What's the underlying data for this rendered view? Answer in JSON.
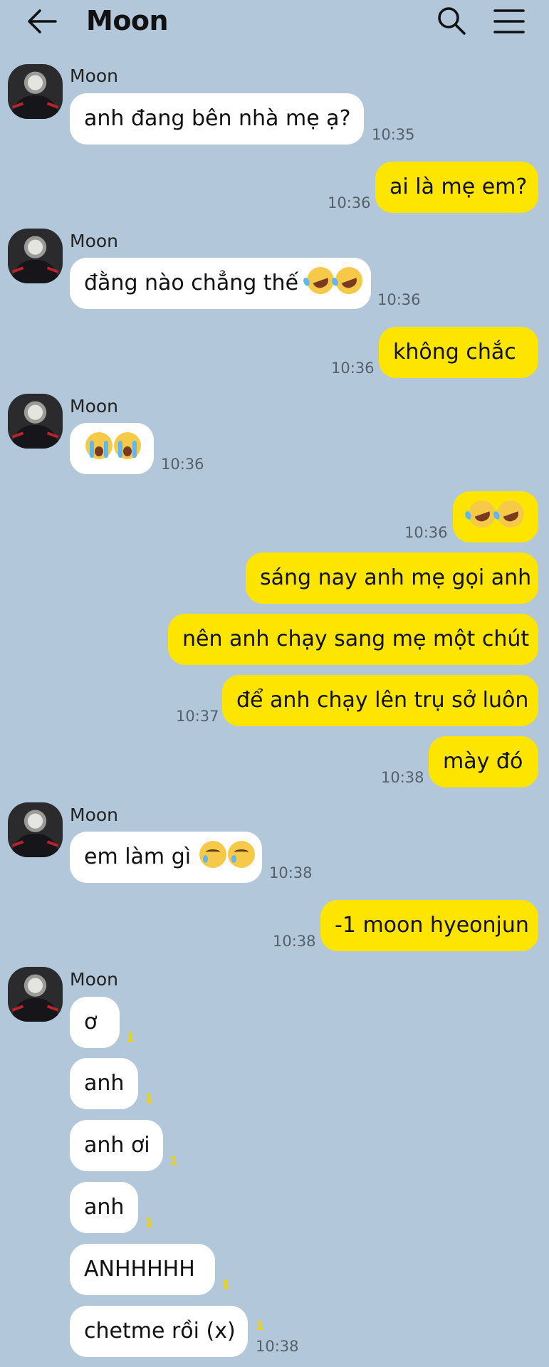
{
  "header": {
    "title": "Moon"
  },
  "icons": {
    "back": "arrow-left-icon",
    "search": "search-icon",
    "menu": "hamburger-menu-icon"
  },
  "colors": {
    "background": "#b2c7d9",
    "incoming_bubble": "#ffffff",
    "outgoing_bubble": "#fee500",
    "unread": "#f0d400"
  },
  "messages": {
    "sender_name": "Moon",
    "m1": {
      "text": "anh đang bên nhà mẹ ạ?",
      "time": "10:35"
    },
    "m2": {
      "text": "ai là mẹ em?",
      "time": "10:36"
    },
    "m3": {
      "text": "đằng nào chẳng thế",
      "emoji": [
        "rofl",
        "rofl"
      ],
      "time": "10:36"
    },
    "m4": {
      "text": "không chắc",
      "time": "10:36"
    },
    "m5": {
      "emoji": [
        "loudly-crying",
        "loudly-crying"
      ],
      "time": "10:36"
    },
    "m6": {
      "emoji": [
        "rofl",
        "rofl"
      ],
      "time": "10:36"
    },
    "m7": {
      "text": "sáng nay anh mẹ gọi anh"
    },
    "m8": {
      "text": "nên anh chạy sang mẹ một chút"
    },
    "m9": {
      "text": "để anh chạy lên trụ sở luôn",
      "time": "10:37"
    },
    "m10": {
      "text": "mày đó",
      "time": "10:38"
    },
    "m11": {
      "text": "em làm gì",
      "emoji": [
        "smiling-with-tear",
        "smiling-with-tear"
      ],
      "time": "10:38"
    },
    "m12": {
      "text": "-1 moon hyeonjun",
      "time": "10:38"
    },
    "m13": {
      "text": "ơ",
      "unread": "1"
    },
    "m14": {
      "text": "anh",
      "unread": "1"
    },
    "m15": {
      "text": "anh ơi",
      "unread": "1"
    },
    "m16": {
      "text": "anh",
      "unread": "1"
    },
    "m17": {
      "text": "ANHHHHH",
      "unread": "1"
    },
    "m18": {
      "text": "chetme rồi (x)",
      "unread": "1",
      "time": "10:38"
    }
  }
}
